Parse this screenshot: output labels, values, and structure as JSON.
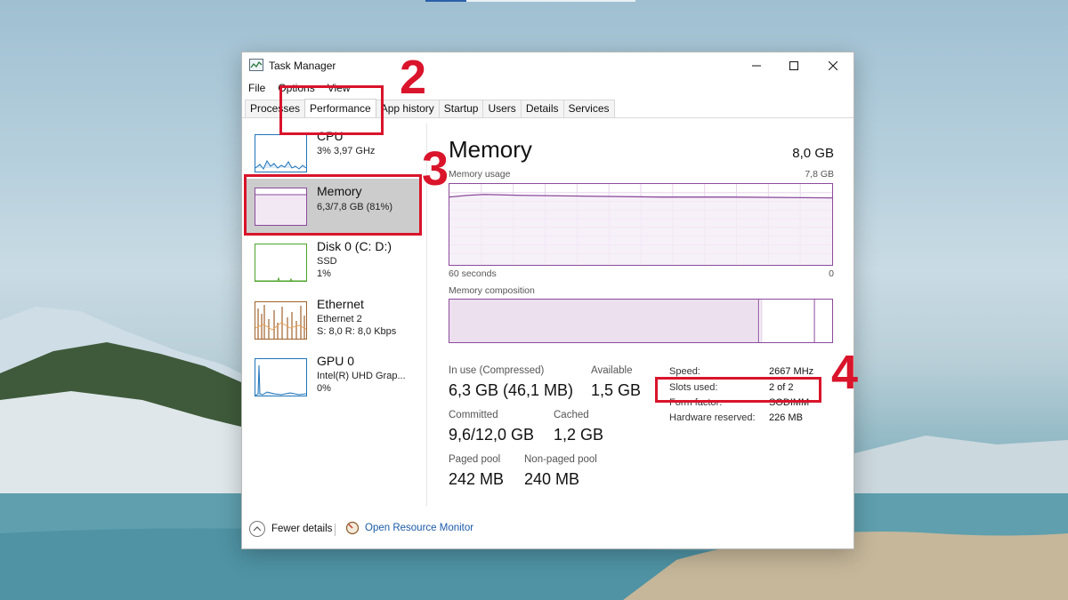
{
  "window": {
    "title": "Task Manager"
  },
  "menu": [
    "File",
    "Options",
    "View"
  ],
  "tabs": [
    "Processes",
    "Performance",
    "App history",
    "Startup",
    "Users",
    "Details",
    "Services"
  ],
  "active_tab": "Performance",
  "sidebar": [
    {
      "name": "CPU",
      "line1": "3% 3,97 GHz",
      "line2": "",
      "color": "#1f74b8"
    },
    {
      "name": "Memory",
      "line1": "6,3/7,8 GB (81%)",
      "line2": "",
      "color": "#8b4a9c"
    },
    {
      "name": "Disk 0 (C: D:)",
      "line1": "SSD",
      "line2": "1%",
      "color": "#4da42b"
    },
    {
      "name": "Ethernet",
      "line1": "Ethernet 2",
      "line2": "S: 8,0  R: 8,0 Kbps",
      "color": "#a0622a"
    },
    {
      "name": "GPU 0",
      "line1": "Intel(R) UHD Grap...",
      "line2": "0%",
      "color": "#1f74b8"
    }
  ],
  "memory": {
    "title": "Memory",
    "total": "8,0 GB",
    "usage_label": "Memory usage",
    "usage_max": "7,8 GB",
    "axis_left": "60 seconds",
    "axis_right": "0",
    "composition_label": "Memory composition",
    "in_use_label": "In use (Compressed)",
    "in_use_value": "6,3 GB (46,1 MB)",
    "available_label": "Available",
    "available_value": "1,5 GB",
    "committed_label": "Committed",
    "committed_value": "9,6/12,0 GB",
    "cached_label": "Cached",
    "cached_value": "1,2 GB",
    "paged_label": "Paged pool",
    "paged_value": "242 MB",
    "nonpaged_label": "Non-paged pool",
    "nonpaged_value": "240 MB",
    "speed_label": "Speed:",
    "speed_value": "2667 MHz",
    "slots_label": "Slots used:",
    "slots_value": "2 of 2",
    "form_label": "Form factor:",
    "form_value": "SODIMM",
    "hw_label": "Hardware reserved:",
    "hw_value": "226 MB",
    "accent": "#8b4a9c"
  },
  "footer": {
    "fewer": "Fewer details",
    "monitor": "Open Resource Monitor"
  },
  "annotations": [
    "2",
    "3",
    "4"
  ],
  "annotation_color": "#d9142b"
}
